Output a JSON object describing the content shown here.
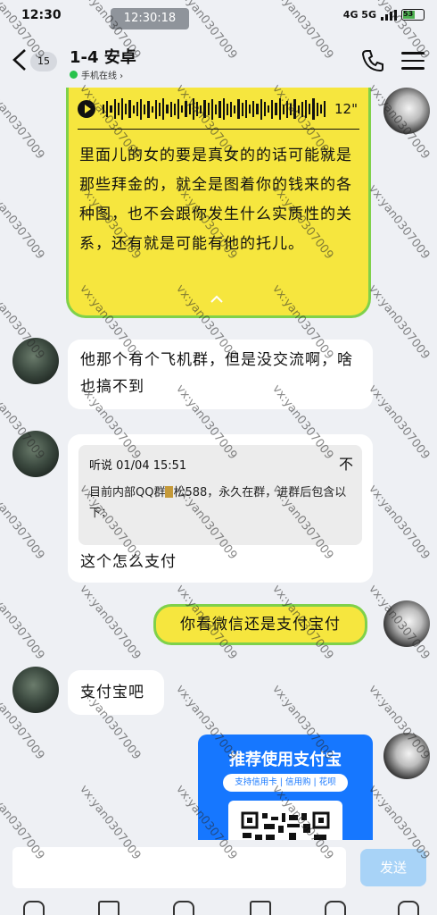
{
  "status_bar": {
    "time": "12:30",
    "time_pill": "12:30:18",
    "network": "4G 5G",
    "battery": "53"
  },
  "header": {
    "back_icon": "chevron-left-icon",
    "unread_count": "15",
    "title": "1-4 安卓",
    "presence": "手机在线 ›",
    "call_icon": "phone-icon",
    "menu_icon": "menu-icon"
  },
  "messages": {
    "voice": {
      "duration": "12\"",
      "transcript": "里面儿的女的要是真女的的话可能就是那些拜金的，就全是图着你的钱来的各种图，也不会跟你发生什么实质性的关系，还有就是可能有他的托儿。"
    },
    "msg2": {
      "text": "他那个有个飞机群，但是没交流啊，啥也搞不到"
    },
    "msg3": {
      "quote_meta": "听说  01/04  15:51",
      "quote_close": "不",
      "quote_body_a": "目前内部QQ群",
      "quote_body_b": "松588，永久在群，进群后包含以下：",
      "text": "这个怎么支付"
    },
    "msg4": {
      "text": "你看微信还是支付宝付"
    },
    "msg5": {
      "text": "支付宝吧"
    },
    "alipay_card": {
      "title": "推荐使用支付宝",
      "subtitle": "支持信用卡 | 信用购 | 花呗"
    }
  },
  "input": {
    "placeholder": "",
    "send_label": "发送"
  },
  "watermark": {
    "text": "vx:yan0307009"
  },
  "colors": {
    "voice_bubble": "#f6e63e",
    "voice_bubble_border": "#7fd14a",
    "alipay_blue": "#1677ff",
    "send_button": "#a8d3f7"
  }
}
